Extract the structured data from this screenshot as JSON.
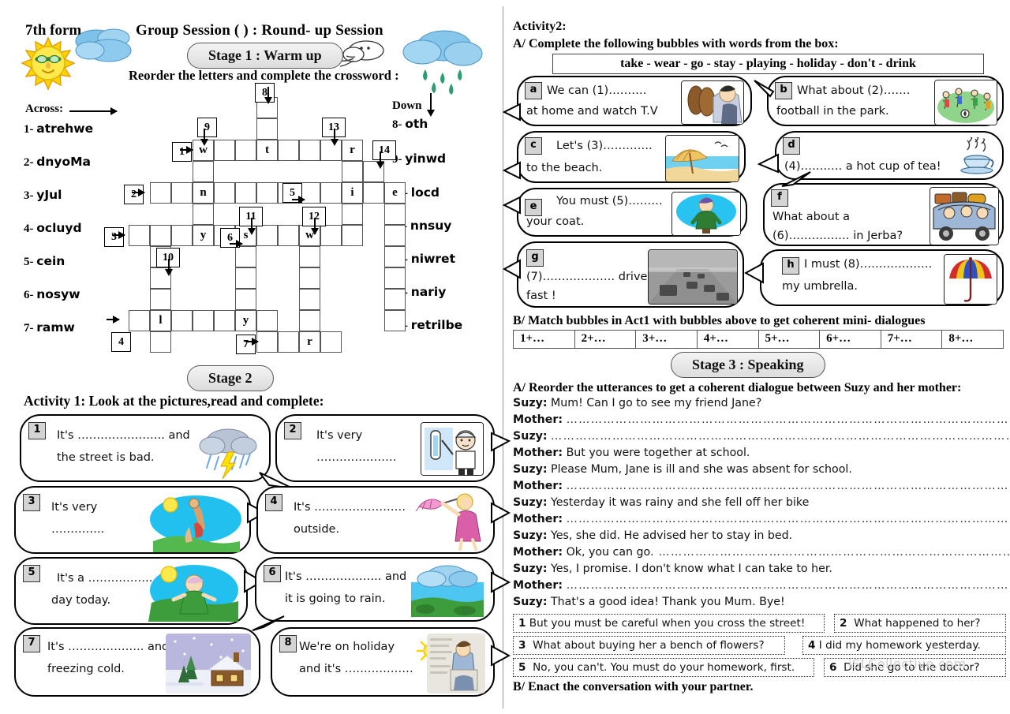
{
  "header": {
    "form": "7th form",
    "session_title": "Group Session (  ) :  Round- up Session",
    "stage1": "Stage 1 : Warm up",
    "stage2": "Stage 2",
    "stage3": "Stage 3 : Speaking",
    "instruction": "Reorder the letters and complete the crossword :"
  },
  "crossword": {
    "across_label": "Across:",
    "down_label": "Down",
    "across": [
      {
        "num": "1-",
        "word": "atrehwe"
      },
      {
        "num": "2-",
        "word": "dnyoMa"
      },
      {
        "num": "3-",
        "word": "yJul"
      },
      {
        "num": "4-",
        "word": "ocluyd"
      },
      {
        "num": "5-",
        "word": "cein"
      },
      {
        "num": "6-",
        "word": "nosyw"
      },
      {
        "num": "7-",
        "word": "ramw"
      }
    ],
    "down": [
      {
        "num": "8-",
        "word": "oth"
      },
      {
        "num": "9-",
        "word": "yinwd"
      },
      {
        "num": "10-",
        "word": "locd"
      },
      {
        "num": "11-",
        "word": "nnsuy"
      },
      {
        "num": "12-",
        "word": "niwret"
      },
      {
        "num": "13-",
        "word": "nariy"
      },
      {
        "num": "14-",
        "word": "retrilbe"
      }
    ],
    "grid_numbers": [
      "1",
      "2",
      "3",
      "4",
      "5",
      "6",
      "7",
      "8",
      "9",
      "10",
      "11",
      "12",
      "13",
      "14"
    ],
    "filled_letters": [
      "w",
      "t",
      "r",
      "n",
      "i",
      "e",
      "y",
      "s",
      "w",
      "l",
      "y",
      "r"
    ]
  },
  "activity1": {
    "title": "Activity 1: Look at the pictures,read and complete:",
    "bubbles": [
      {
        "tag": "1",
        "line1": "It's ………………….. and",
        "line2": "the street is bad.",
        "picture": "storm-cloud-rain-lightning"
      },
      {
        "tag": "2",
        "line1": "It's very",
        "line2": "…………………",
        "picture": "boy-cold-thermometer"
      },
      {
        "tag": "3",
        "line1": "It's  very",
        "line2": "…………..",
        "picture": "sunbathing-hot-beach"
      },
      {
        "tag": "4",
        "line1": "It's ……………………",
        "line2": "outside.",
        "picture": "woman-windy-umbrella"
      },
      {
        "tag": "5",
        "line1": "It's a ……………..",
        "line2": "day today.",
        "picture": "sunny-person-field"
      },
      {
        "tag": "6",
        "line1": "It's ……………….. and",
        "line2": "it is going to rain.",
        "picture": "cloudy-sky-field"
      },
      {
        "tag": "7",
        "line1": "It's ……………….. and",
        "line2": "freezing cold.",
        "picture": "snowy-house-winter"
      },
      {
        "tag": "8",
        "line1": "We're on holiday",
        "line2": "and it's ………………",
        "picture": "man-relaxing-sun"
      }
    ]
  },
  "activity2": {
    "title": "Activity2:",
    "sub_a": "A/ Complete the following bubbles with words from the box:",
    "wordbox": "take  -  wear  -  go  -  stay  -  playing  -  holiday  -  don't  -  drink",
    "bubbles": [
      {
        "tag": "a",
        "line1": "We can (1)……….",
        "line2": "at home and watch T.V",
        "picture": "man-lying-watching-tv"
      },
      {
        "tag": "b",
        "line1": "What about (2)…….",
        "line2": "football in the park.",
        "picture": "kids-playing-football"
      },
      {
        "tag": "c",
        "line1": "Let's (3)………….",
        "line2": "to the beach.",
        "picture": "beach-parasol-sea"
      },
      {
        "tag": "d",
        "line1": "",
        "line2": "(4)…….…. a hot cup of tea!",
        "picture": "steaming-teacup"
      },
      {
        "tag": "e",
        "line1": "You must (5)………",
        "line2": "your coat.",
        "picture": "person-cold-coat"
      },
      {
        "tag": "f",
        "line1": "What about a",
        "line2": "(6)………….… in Jerba?",
        "picture": "family-car-luggage"
      },
      {
        "tag": "g",
        "line1": "(7)………………. drive",
        "line2": "fast !",
        "picture": "foggy-road-traffic"
      },
      {
        "tag": "h",
        "line1": "I must (8)……………….",
        "line2": "my umbrella.",
        "picture": "colorful-umbrella"
      }
    ],
    "sub_b": "B/ Match bubbles in Act1 with bubbles above to get coherent mini- dialogues",
    "match_cells": [
      "1+…",
      "2+…",
      "3+…",
      "4+…",
      "5+…",
      "6+…",
      "7+…",
      "8+…"
    ]
  },
  "stage3": {
    "sub_a": "A/  Reorder the utterances to get a coherent dialogue between Suzy and her mother:",
    "sub_b": "B/   Enact the conversation with your partner.",
    "dialogue": [
      {
        "speaker": "Suzy:",
        "text": "Mum! Can I go to see my friend Jane?",
        "dots": ""
      },
      {
        "speaker": "Mother:",
        "text": "",
        "dots": "…………………………………………………………………………………………………………………"
      },
      {
        "speaker": "Suzy:",
        "text": "",
        "dots": "……………………………………………………………………………………………………………………"
      },
      {
        "speaker": "Mother:",
        "text": "But you were together at school.",
        "dots": ""
      },
      {
        "speaker": "Suzy:",
        "text": "Please Mum, Jane is ill and she was absent for school.",
        "dots": ""
      },
      {
        "speaker": "Mother:",
        "text": "",
        "dots": "…………………………………………………………………………………………………………………"
      },
      {
        "speaker": "Suzy:",
        "text": "Yesterday it was rainy and she fell off her bike",
        "dots": ""
      },
      {
        "speaker": "Mother:",
        "text": "",
        "dots": "…………………………………………………………………………………………………………………"
      },
      {
        "speaker": "Suzy:",
        "text": "Yes, she did. He advised her to stay in bed.",
        "dots": ""
      },
      {
        "speaker": "Mother:",
        "text": "Ok, you can go.",
        "dots": " …………………………………………………………………………………………"
      },
      {
        "speaker": "Suzy:",
        "text": "Yes, I promise. I don't know what I can take to her.",
        "dots": ""
      },
      {
        "speaker": "Mother:",
        "text": "",
        "dots": "…………………………………………………………………………………………………………………"
      },
      {
        "speaker": "Suzy:",
        "text": "That's a good idea! Thank you Mum. Bye!",
        "dots": ""
      }
    ],
    "utterances": [
      {
        "num": "1",
        "text": "But you must be careful when you cross the street!"
      },
      {
        "num": "2",
        "text": "What happened to her?"
      },
      {
        "num": "3",
        "text": "What about buying her a bench of flowers?"
      },
      {
        "num": "4",
        "text": "I did my homework yesterday."
      },
      {
        "num": "5",
        "text": "No, you can't. You must do your homework, first."
      },
      {
        "num": "6",
        "text": "Did she go to the doctor?"
      }
    ]
  },
  "watermark": "iSLCollective.com",
  "colors": {
    "pill_bg": "#dcdcdc",
    "tag_bg": "#d4d4d4",
    "cell_border": "#555555",
    "sun": "#ffe427",
    "cloud": "#9cc9e8",
    "sky": "#22c0ef",
    "grass": "#3aa34a"
  }
}
